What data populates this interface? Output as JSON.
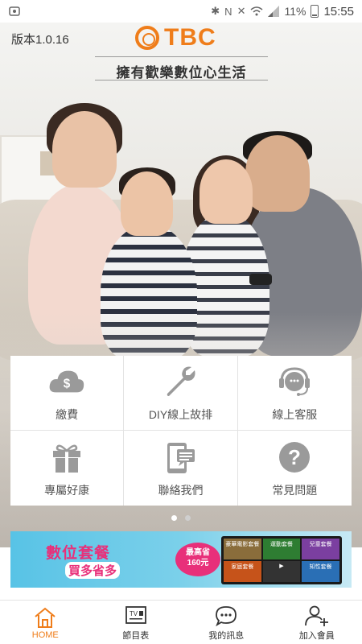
{
  "status_bar": {
    "battery": "11%",
    "time": "15:55"
  },
  "header": {
    "version": "版本1.0.16",
    "logo_text": "TBC",
    "slogan": "擁有歡樂數位心生活"
  },
  "colors": {
    "brand": "#ef7d1a",
    "icon_gray": "#9a9a9a",
    "banner_pink": "#e8307a"
  },
  "menu": {
    "items": [
      {
        "label": "繳費",
        "icon": "pay-icon"
      },
      {
        "label": "DIY線上故排",
        "icon": "wrench-icon"
      },
      {
        "label": "線上客服",
        "icon": "headset-icon"
      },
      {
        "label": "專屬好康",
        "icon": "gift-icon"
      },
      {
        "label": "聯絡我們",
        "icon": "phone-chat-icon"
      },
      {
        "label": "常見問題",
        "icon": "question-icon"
      }
    ]
  },
  "pager": {
    "count": 2,
    "active_index": 0
  },
  "banner": {
    "title": "數位套餐",
    "subtitle": "買多省多",
    "price_top": "最高省",
    "price_value": "160元",
    "tiles": [
      "豪華電影套餐",
      "運動套餐",
      "兒童套餐",
      "家庭套餐",
      "",
      "知性套餐"
    ]
  },
  "bottom_nav": {
    "items": [
      {
        "label": "HOME",
        "icon": "home-icon",
        "active": true
      },
      {
        "label": "節目表",
        "icon": "tv-guide-icon",
        "tv_text": "TV",
        "active": false
      },
      {
        "label": "我的訊息",
        "icon": "message-icon",
        "active": false
      },
      {
        "label": "加入會員",
        "icon": "add-member-icon",
        "active": false
      }
    ]
  }
}
